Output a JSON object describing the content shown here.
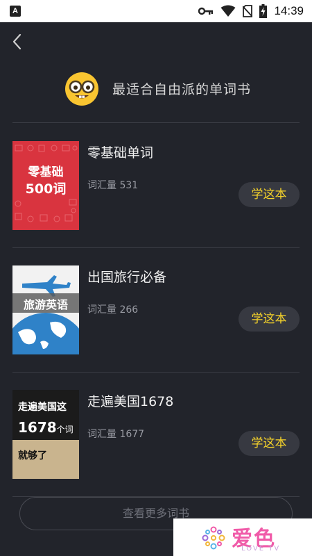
{
  "statusbar": {
    "time": "14:39",
    "app_letter": "A"
  },
  "header": {
    "title": "最适合自由派的单词书"
  },
  "books": [
    {
      "title": "零基础单词",
      "count_label": "词汇量 531",
      "button": "学这本",
      "cover": {
        "line1": "零基础",
        "line2": "500词",
        "bg": "#d9343f"
      }
    },
    {
      "title": "出国旅行必备",
      "count_label": "词汇量 266",
      "button": "学这本",
      "cover": {
        "text": "旅游英语",
        "bg": "#ffffff"
      }
    },
    {
      "title": "走遍美国1678",
      "count_label": "词汇量 1677",
      "button": "学这本",
      "cover": {
        "line1": "走遍美国这",
        "line2a": "1678",
        "line2b": "个词",
        "line3": "就够了"
      }
    }
  ],
  "more": {
    "label": "查看更多词书"
  },
  "watermark": {
    "text": "爱色",
    "sub": "LOVE TV"
  },
  "colors": {
    "accent": "#f7d42a",
    "background": "#22242b"
  }
}
